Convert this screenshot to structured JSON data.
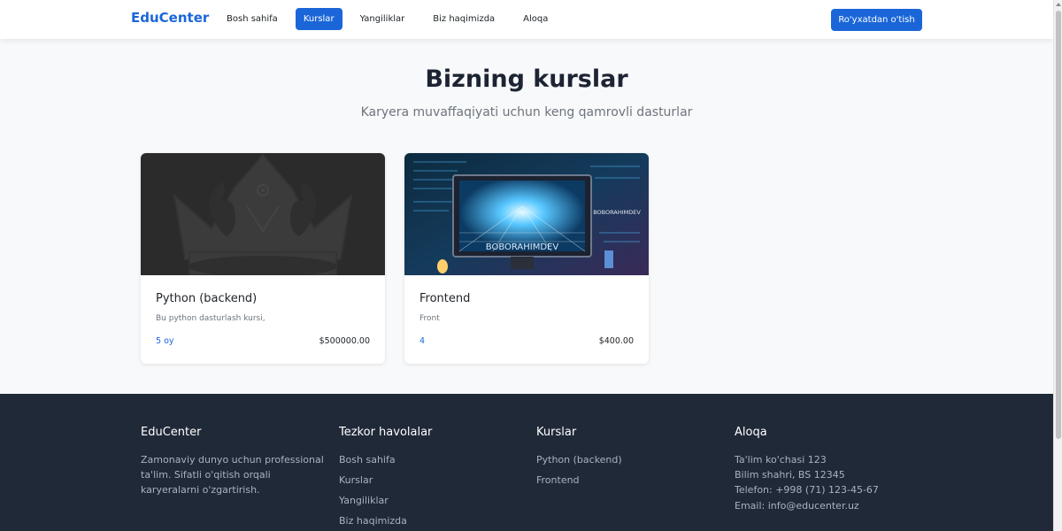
{
  "nav": {
    "brand": "EduCenter",
    "links": [
      {
        "label": "Bosh sahifa",
        "active": false
      },
      {
        "label": "Kurslar",
        "active": true
      },
      {
        "label": "Yangiliklar",
        "active": false
      },
      {
        "label": "Biz haqimizda",
        "active": false
      },
      {
        "label": "Aloqa",
        "active": false
      }
    ],
    "register_label": "Ro'yxatdan o'tish"
  },
  "hero": {
    "title": "Bizning kurslar",
    "subtitle": "Karyera muvaffaqiyati uchun keng qamrovli dasturlar"
  },
  "courses": [
    {
      "title": "Python (backend)",
      "description": "Bu python dasturlash kursi,",
      "duration": "5 oy",
      "price": "$500000.00",
      "image": "crown-logo-image"
    },
    {
      "title": "Frontend",
      "description": "Front",
      "duration": "4",
      "price": "$400.00",
      "image": "tech-computer-image",
      "image_text": "BOBORAHIMDEV"
    }
  ],
  "footer": {
    "about": {
      "heading": "EduCenter",
      "text": "Zamonaviy dunyo uchun professional ta'lim. Sifatli o'qitish orqali karyeralarni o'zgartirish."
    },
    "quick_links": {
      "heading": "Tezkor havolalar",
      "items": [
        "Bosh sahifa",
        "Kurslar",
        "Yangiliklar",
        "Biz haqimizda"
      ]
    },
    "courses": {
      "heading": "Kurslar",
      "items": [
        "Python (backend)",
        "Frontend"
      ]
    },
    "contact": {
      "heading": "Aloqa",
      "lines": [
        "Ta'lim ko'chasi 123",
        "Bilim shahri, BS 12345",
        "Telefon: +998 (71) 123-45-67",
        "Email: info@educenter.uz"
      ]
    }
  },
  "colors": {
    "primary": "#1a66d9",
    "footer_bg": "#202938",
    "page_bg": "#f8f9fa"
  }
}
